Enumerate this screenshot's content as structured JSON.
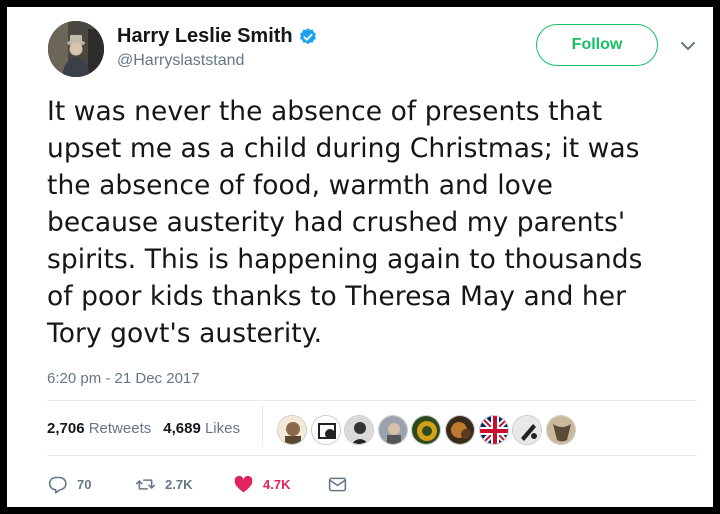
{
  "user": {
    "name": "Harry Leslie Smith",
    "handle": "@Harryslaststand"
  },
  "follow_label": "Follow",
  "tweet": {
    "lines": [
      "It was never the absence of presents that",
      "upset me as a child during Christmas; it was",
      "the absence of food, warmth and love",
      "because austerity had crushed my parents'",
      "spirits. This is happening again to thousands",
      "of poor kids thanks to Theresa May and her",
      "Tory govt's austerity."
    ],
    "timestamp": "6:20 pm - 21 Dec 2017"
  },
  "stats": {
    "retweets_count": "2,706",
    "retweets_label": "Retweets",
    "likes_count": "4,689",
    "likes_label": "Likes"
  },
  "actions": {
    "reply_count": "70",
    "retweet_count": "2.7K",
    "like_count": "4.7K"
  },
  "colors": {
    "accent_green": "#17bf63",
    "heart_red": "#e0245e",
    "verified_blue": "#1da1f2",
    "muted": "#657786"
  },
  "icons": [
    "verified-badge-icon",
    "chevron-down-icon",
    "reply-icon",
    "retweet-icon",
    "heart-icon",
    "envelope-icon"
  ]
}
